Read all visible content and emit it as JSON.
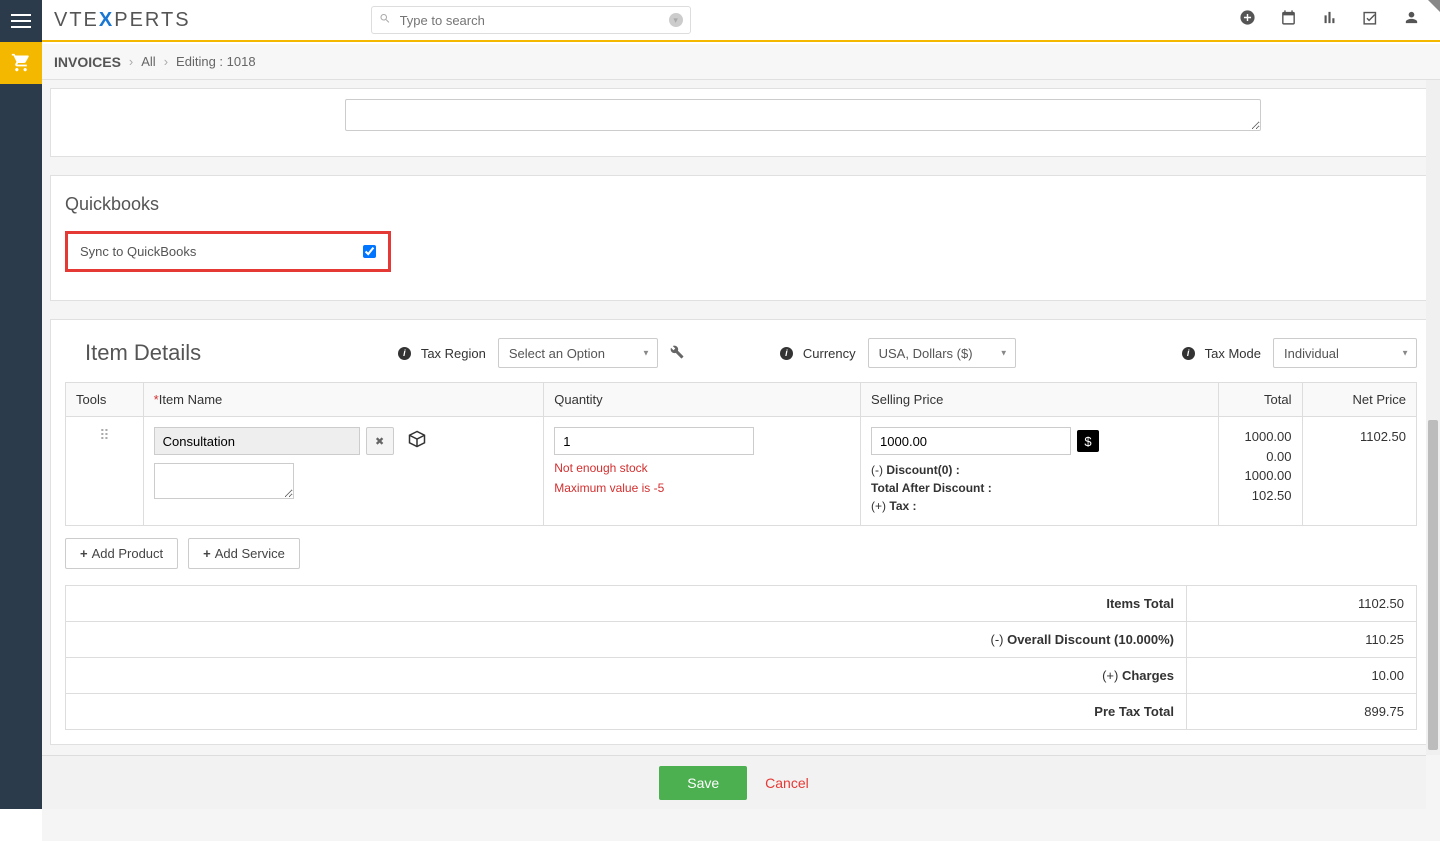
{
  "header": {
    "logo_pre": "VTE",
    "logo_bold": "X",
    "logo_post": "PERTS",
    "search_placeholder": "Type to search"
  },
  "breadcrumb": {
    "module": "INVOICES",
    "all": "All",
    "editing": "Editing : 1018"
  },
  "quickbooks": {
    "section_title": "Quickbooks",
    "sync_label": "Sync to QuickBooks",
    "sync_checked": true
  },
  "item_details": {
    "title": "Item Details",
    "tax_region_label": "Tax Region",
    "tax_region_value": "Select an Option",
    "currency_label": "Currency",
    "currency_value": "USA, Dollars ($)",
    "tax_mode_label": "Tax Mode",
    "tax_mode_value": "Individual",
    "columns": {
      "tools": "Tools",
      "item_name": "Item Name",
      "quantity": "Quantity",
      "selling_price": "Selling Price",
      "total": "Total",
      "net_price": "Net Price"
    },
    "row": {
      "name": "Consultation",
      "quantity": "1",
      "stock_error1": "Not enough stock",
      "stock_error2": "Maximum value is -5",
      "selling_price": "1000.00",
      "discount_label": "Discount(0) :",
      "after_discount_label": "Total After Discount :",
      "tax_label": "Tax :",
      "total": "1000.00",
      "discount_amt": "0.00",
      "after_discount_amt": "1000.00",
      "tax_amt": "102.50",
      "net_price": "1102.50"
    },
    "add_product": "Add Product",
    "add_service": "Add Service"
  },
  "summary": {
    "items_total_label": "Items Total",
    "items_total": "1102.50",
    "overall_discount_label": "Overall Discount (10.000%)",
    "overall_discount": "110.25",
    "charges_label": "Charges",
    "charges": "10.00",
    "pre_tax_total_label": "Pre Tax Total",
    "pre_tax_total": "899.75"
  },
  "actions": {
    "save": "Save",
    "cancel": "Cancel"
  }
}
